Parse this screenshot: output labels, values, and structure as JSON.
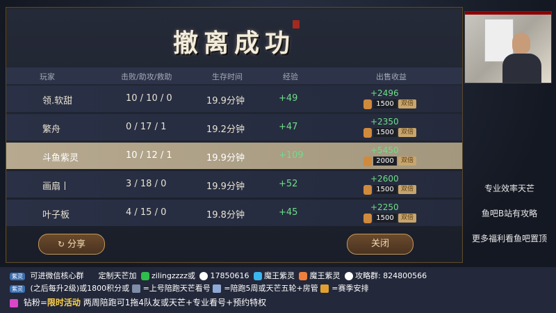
{
  "title": "撤离成功",
  "columns": [
    "玩家",
    "击败/助攻/救助",
    "生存时间",
    "经验",
    "出售收益"
  ],
  "players": [
    {
      "name": "领.软甜",
      "kda": "10 / 10 / 0",
      "time": "19.9分钟",
      "xp": "+49",
      "gain": "+2496",
      "base": "1500",
      "mult": "双倍",
      "highlight": false
    },
    {
      "name": "繁舟",
      "kda": "0 / 17 / 1",
      "time": "19.2分钟",
      "xp": "+47",
      "gain": "+2350",
      "base": "1500",
      "mult": "双倍",
      "highlight": false
    },
    {
      "name": "斗鱼紫灵",
      "kda": "10 / 12 / 1",
      "time": "19.9分钟",
      "xp": "+109",
      "gain": "+5450",
      "base": "2000",
      "mult": "双倍",
      "highlight": true
    },
    {
      "name": "画扇丨",
      "kda": "3 / 18 / 0",
      "time": "19.9分钟",
      "xp": "+52",
      "gain": "+2600",
      "base": "1500",
      "mult": "双倍",
      "highlight": false
    },
    {
      "name": "叶子板",
      "kda": "4 / 15 / 0",
      "time": "19.8分钟",
      "xp": "+45",
      "gain": "+2250",
      "base": "1500",
      "mult": "双倍",
      "highlight": false
    }
  ],
  "buttons": {
    "share": "分享",
    "close": "关闭"
  },
  "side_texts": [
    "专业效率天芒",
    "鱼吧B站有攻略",
    "更多福利看鱼吧置顶"
  ],
  "banner": {
    "tag": "紫灵",
    "line1": {
      "a": "可进微信核心群",
      "b": "定制天芒加",
      "c": "zilingzzzz或",
      "d": "17850616",
      "e": "魔王紫灵",
      "f": "魔王紫灵",
      "g": "攻略群: 824800566"
    },
    "line2": {
      "a": "(之后每升2级)或1800积分或",
      "b": "=上号陪跑天芒看号",
      "c": "=陪跑5周或天芒五轮+房管",
      "d": "=赛季安排"
    },
    "line3": {
      "a": "钻粉=",
      "b": "限时活动",
      "c": "两周陪跑可1拖4队友或天芒+专业看号+预约特权"
    }
  }
}
